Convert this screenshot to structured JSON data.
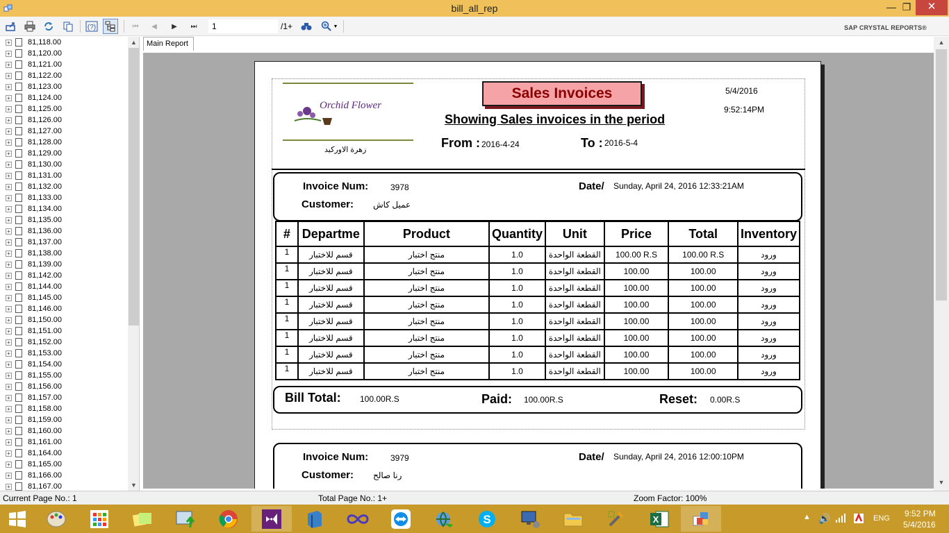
{
  "window": {
    "title": "bill_all_rep"
  },
  "toolbar": {
    "page_value": "1",
    "page_total": "/1+",
    "brand": "SAP CRYSTAL REPORTS®"
  },
  "tree": {
    "items": [
      "81,118.00",
      "81,120.00",
      "81,121.00",
      "81,122.00",
      "81,123.00",
      "81,124.00",
      "81,125.00",
      "81,126.00",
      "81,127.00",
      "81,128.00",
      "81,129.00",
      "81,130.00",
      "81,131.00",
      "81,132.00",
      "81,133.00",
      "81,134.00",
      "81,135.00",
      "81,136.00",
      "81,137.00",
      "81,138.00",
      "81,139.00",
      "81,142.00",
      "81,144.00",
      "81,145.00",
      "81,146.00",
      "81,150.00",
      "81,151.00",
      "81,152.00",
      "81,153.00",
      "81,154.00",
      "81,155.00",
      "81,156.00",
      "81,157.00",
      "81,158.00",
      "81,159.00",
      "81,160.00",
      "81,161.00",
      "81,164.00",
      "81,165.00",
      "81,166.00",
      "81,167.00"
    ]
  },
  "tabs": {
    "main": "Main Report"
  },
  "report": {
    "logo_text": "Orchid Flower",
    "logo_arabic": "زهرة الاوركيد",
    "title": "Sales Invoices",
    "subtitle": "Showing Sales invoices in the period",
    "print_date": "5/4/2016",
    "print_time": "9:52:14PM",
    "from_label": "From :",
    "from_value": "2016-4-24",
    "to_label": "To :",
    "to_value": "2016-5-4",
    "invoice1": {
      "num_label": "Invoice Num:",
      "num": "3978",
      "date_label": "Date/",
      "date": "Sunday, April 24, 2016  12:33:21AM",
      "customer_label": "Customer:",
      "customer": "عميل كاش",
      "columns": [
        "#",
        "Departme",
        "Product",
        "Quantity",
        "Unit",
        "Price",
        "Total",
        "Inventory"
      ],
      "rows": [
        [
          "1",
          "قسم للاختبار",
          "منتج اختبار",
          "1.0",
          "القطعة الواحدة",
          "100.00 R.S",
          "100.00 R.S",
          "ورود"
        ],
        [
          "1",
          "قسم للاختبار",
          "منتج اختبار",
          "1.0",
          "القطعة الواحدة",
          "100.00",
          "100.00",
          "ورود"
        ],
        [
          "1",
          "قسم للاختبار",
          "منتج اختبار",
          "1.0",
          "القطعة الواحدة",
          "100.00",
          "100.00",
          "ورود"
        ],
        [
          "1",
          "قسم للاختبار",
          "منتج اختبار",
          "1.0",
          "القطعة الواحدة",
          "100.00",
          "100.00",
          "ورود"
        ],
        [
          "1",
          "قسم للاختبار",
          "منتج اختبار",
          "1.0",
          "القطعة الواحدة",
          "100.00",
          "100.00",
          "ورود"
        ],
        [
          "1",
          "قسم للاختبار",
          "منتج اختبار",
          "1.0",
          "القطعة الواحدة",
          "100.00",
          "100.00",
          "ورود"
        ],
        [
          "1",
          "قسم للاختبار",
          "منتج اختبار",
          "1.0",
          "القطعة الواحدة",
          "100.00",
          "100.00",
          "ورود"
        ],
        [
          "1",
          "قسم للاختبار",
          "منتج اختبار",
          "1.0",
          "القطعة الواحدة",
          "100.00",
          "100.00",
          "ورود"
        ]
      ],
      "bill_total_label": "Bill Total:",
      "bill_total": "100.00R.S",
      "paid_label": "Paid:",
      "paid": "100.00R.S",
      "reset_label": "Reset:",
      "reset": "0.00R.S"
    },
    "invoice2": {
      "num_label": "Invoice Num:",
      "num": "3979",
      "date_label": "Date/",
      "date": "Sunday, April 24, 2016  12:00:10PM",
      "customer_label": "Customer:",
      "customer": "رنا صالح"
    }
  },
  "status": {
    "current_page": "Current Page No.: 1",
    "total_page": "Total Page No.: 1+",
    "zoom": "Zoom Factor: 100%"
  },
  "taskbar": {
    "lang": "ENG",
    "time": "9:52 PM",
    "date": "5/4/2016"
  },
  "colors": {
    "titlebar": "#f0c15a",
    "taskbar": "#c89a2a",
    "title_box": "#f5a3a7",
    "title_text": "#8b0000"
  }
}
